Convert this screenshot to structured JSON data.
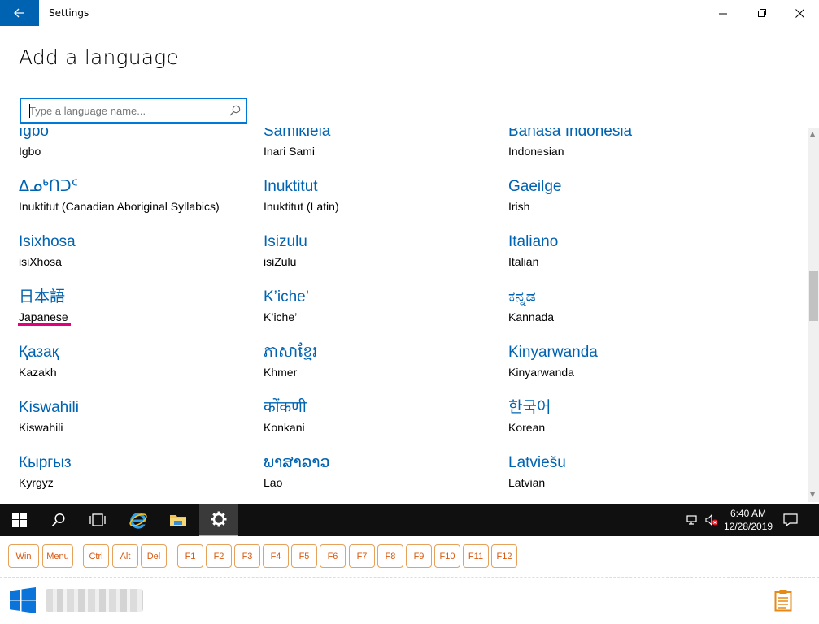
{
  "window": {
    "title": "Settings"
  },
  "page": {
    "heading": "Add a language"
  },
  "search": {
    "placeholder": "Type a language name...",
    "value": ""
  },
  "languages": [
    {
      "native": "Igbo",
      "english": "Igbo"
    },
    {
      "native": "Sämikielâ",
      "english": "Inari Sami"
    },
    {
      "native": "Bahasa Indonesia",
      "english": "Indonesian"
    },
    {
      "native": "ᐃᓄᒃᑎᑐᑦ",
      "english": "Inuktitut (Canadian Aboriginal Syllabics)"
    },
    {
      "native": "Inuktitut",
      "english": "Inuktitut (Latin)"
    },
    {
      "native": "Gaeilge",
      "english": "Irish"
    },
    {
      "native": "Isixhosa",
      "english": "isiXhosa"
    },
    {
      "native": "Isizulu",
      "english": "isiZulu"
    },
    {
      "native": "Italiano",
      "english": "Italian"
    },
    {
      "native": "日本語",
      "english": "Japanese"
    },
    {
      "native": "K’iche’",
      "english": "K’iche’"
    },
    {
      "native": "ಕನ್ನಡ",
      "english": "Kannada"
    },
    {
      "native": "Қазақ",
      "english": "Kazakh"
    },
    {
      "native": "ភាសាខ្មែរ",
      "english": "Khmer"
    },
    {
      "native": "Kinyarwanda",
      "english": "Kinyarwanda"
    },
    {
      "native": "Kiswahili",
      "english": "Kiswahili"
    },
    {
      "native": "कोंकणी",
      "english": "Konkani"
    },
    {
      "native": "한국어",
      "english": "Korean"
    },
    {
      "native": "Кыргыз",
      "english": "Kyrgyz"
    },
    {
      "native": "ພາສາລາວ",
      "english": "Lao"
    },
    {
      "native": "Latviešu",
      "english": "Latvian"
    }
  ],
  "taskbar": {
    "items": [
      "windows-start",
      "search",
      "task-view",
      "internet-explorer",
      "file-explorer",
      "settings"
    ],
    "time": "6:40 AM",
    "date": "12/28/2019"
  },
  "function_keys": [
    "Win",
    "Menu",
    "Ctrl",
    "Alt",
    "Del",
    "F1",
    "F2",
    "F3",
    "F4",
    "F5",
    "F6",
    "F7",
    "F8",
    "F9",
    "F10",
    "F11",
    "F12"
  ],
  "colors": {
    "accent": "#0063b1",
    "focus": "#e3007b",
    "key_border": "#e6a15a",
    "key_text": "#d9580e"
  }
}
